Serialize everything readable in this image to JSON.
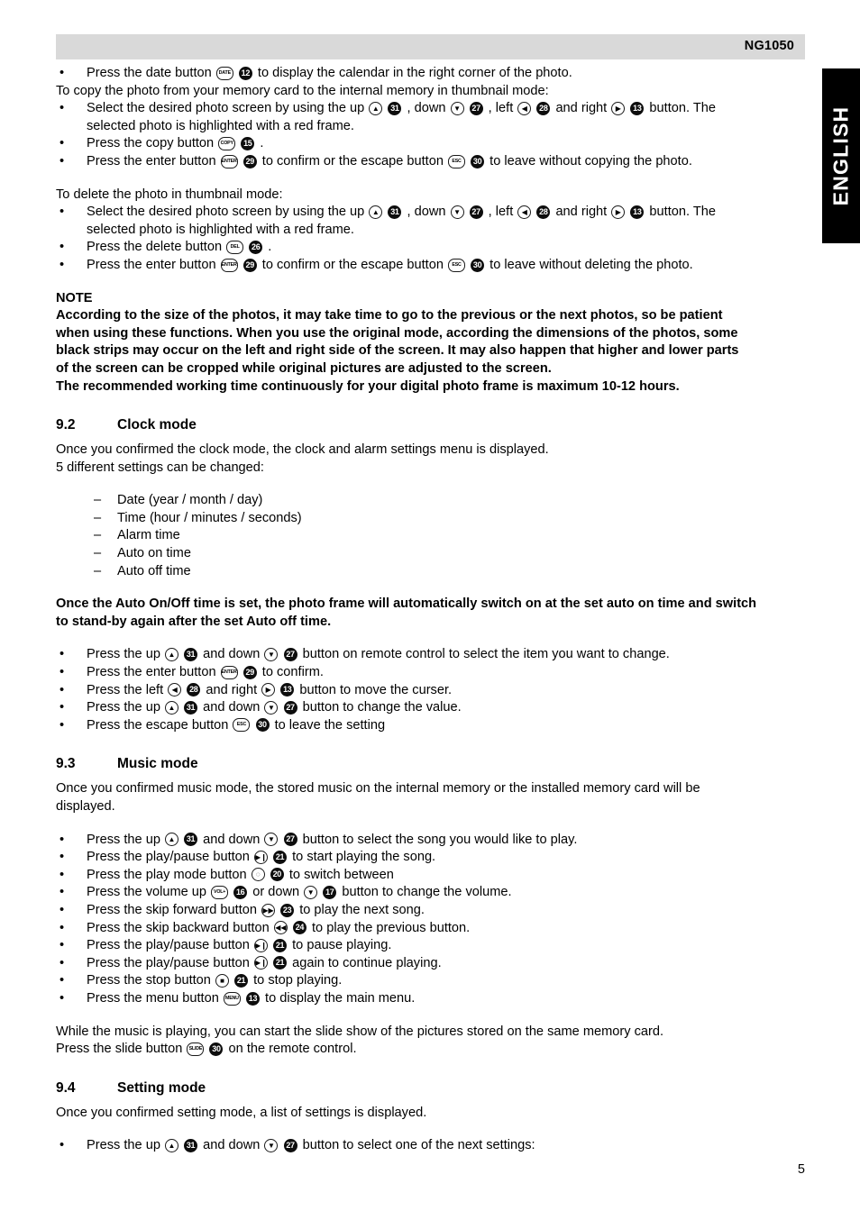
{
  "header": {
    "model": "NG1050",
    "language_tab": "ENGLISH"
  },
  "page_number": "5",
  "icons": {
    "date": "DATE",
    "copy": "COPY",
    "delete": "DEL",
    "enter": "ENTER",
    "escape": "ESC",
    "up": "▲",
    "down": "▼",
    "left": "◀",
    "right": "▶",
    "play_pause": "▶❙",
    "play_mode": "◌",
    "volume_up": "VOL+",
    "volume_down": "▼",
    "skip_forward": "▶▶",
    "skip_backward": "◀◀",
    "stop": "■",
    "menu": "MENU",
    "slide": "SLIDE"
  },
  "callouts": {
    "date": "12",
    "up": "31",
    "down": "27",
    "left": "28",
    "right": "13",
    "copy": "15",
    "enter": "29",
    "escape": "30",
    "delete": "26",
    "play_pause": "21",
    "play_mode": "20",
    "volume_up": "16",
    "volume_down": "17",
    "skip_forward": "23",
    "skip_backward": "24",
    "stop": "21",
    "menu": "13",
    "slide": "30"
  },
  "body": {
    "b1_pre": "Press the date button",
    "b1_post": "to display the calendar in the right corner of the photo.",
    "copy_intro": "To copy the photo from your memory card to the internal memory in thumbnail mode:",
    "select_pre": "Select the desired photo screen by using the up",
    "select_mid1": ", down",
    "select_mid2": ", left",
    "select_mid3": "and right",
    "select_post": "button. The",
    "select_line2": "selected photo is highlighted with a red frame.",
    "copy_btn_pre": "Press the copy button",
    "copy_btn_post": ".",
    "enter_copy_pre": "Press the enter button",
    "enter_copy_mid": "to confirm or the escape button",
    "enter_copy_post": "to leave without copying the photo.",
    "delete_intro": "To delete the photo in thumbnail mode:",
    "delete_btn_pre": "Press the delete button",
    "delete_btn_post": ".",
    "enter_del_mid": "to confirm or the escape button",
    "enter_del_post": "to leave without deleting the photo.",
    "note_title": "NOTE",
    "note_l1": "According to the size of the photos, it may take time to go to the previous or the next photos, so be patient",
    "note_l2": "when using these functions. When you use the original mode, according the dimensions of the photos, some",
    "note_l3": "black strips may occur on the left and right side of the screen. It may also happen that higher and lower parts",
    "note_l4": "of the screen can be cropped while original pictures are adjusted to the screen.",
    "note_l5": "The recommended working time continuously for your digital photo frame is maximum 10-12 hours."
  },
  "section_92": {
    "number": "9.2",
    "title": "Clock mode",
    "intro_l1": "Once you confirmed the clock mode, the clock and alarm settings menu is displayed.",
    "intro_l2": "5 different settings can be changed:",
    "items": [
      "Date (year / month / day)",
      "Time (hour / minutes / seconds)",
      "Alarm time",
      "Auto on time",
      "Auto off time"
    ],
    "bold_l1": "Once the Auto On/Off time is set, the photo frame will automatically switch on at the set auto on time and switch",
    "bold_l2": "to stand-by again after the set Auto off time.",
    "b_updown_pre": "Press the up",
    "b_updown_mid": "and down",
    "b_updown_post": "button on remote control to select the item you want to change.",
    "b_enter_pre": "Press the enter button",
    "b_enter_post": "to confirm.",
    "b_leftright_pre": "Press the left",
    "b_leftright_mid": "and right",
    "b_leftright_post": "button to move the curser.",
    "b_changeval_pre": "Press the up",
    "b_changeval_mid": "and down",
    "b_changeval_post": "button to change the value.",
    "b_escape_pre": "Press the escape button",
    "b_escape_post": "to leave the setting"
  },
  "section_93": {
    "number": "9.3",
    "title": "Music mode",
    "intro_l1": "Once you confirmed music mode, the stored music on the internal memory or the installed memory card will be",
    "intro_l2": "displayed.",
    "b_select_pre": "Press the up",
    "b_select_mid": "and down",
    "b_select_post": "button to select the song you would like to play.",
    "b_play_pre": "Press the play/pause button",
    "b_play_post": "to start playing the song.",
    "b_mode_pre": "Press the play mode button",
    "b_mode_post": "to switch between",
    "b_vol_pre": "Press the volume up",
    "b_vol_mid": "or down",
    "b_vol_post": "button to change the volume.",
    "b_fwd_pre": "Press the skip forward button",
    "b_fwd_post": "to play the next song.",
    "b_bwd_pre": "Press the skip backward button",
    "b_bwd_post": "to play the previous button.",
    "b_pause_pre": "Press the play/pause button",
    "b_pause_post": "to pause playing.",
    "b_resume_pre": "Press the play/pause button",
    "b_resume_post": "again to continue playing.",
    "b_stop_pre": "Press the stop button",
    "b_stop_post": "to stop playing.",
    "b_menu_pre": "Press the menu button",
    "b_menu_post": "to display the main menu.",
    "outro_l1": "While the music is playing, you can start the slide show of the pictures stored on the same memory card.",
    "outro_l2_pre": "Press the slide button",
    "outro_l2_post": "on the remote control."
  },
  "section_94": {
    "number": "9.4",
    "title": "Setting mode",
    "intro": "Once you confirmed setting mode, a list of settings is displayed.",
    "b_updown_pre": "Press the up",
    "b_updown_mid": "and down",
    "b_updown_post": "button to select one of the next settings:"
  }
}
